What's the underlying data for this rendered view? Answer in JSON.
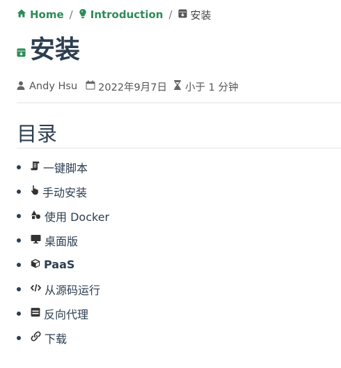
{
  "breadcrumb": {
    "home": {
      "label": "Home",
      "icon": "home-icon"
    },
    "section": {
      "label": "Introduction",
      "icon": "lightbulb-icon"
    },
    "current": {
      "label": "安装",
      "icon": "install-icon"
    }
  },
  "page": {
    "title": "安装",
    "title_icon": "install-icon",
    "accent_color": "#2e8b57"
  },
  "meta": {
    "author": "Andy Hsu",
    "date": "2022年9月7日",
    "reading_time": "小于 1 分钟"
  },
  "toc": {
    "heading": "目录",
    "items": [
      {
        "label": "一键脚本",
        "icon": "script-icon"
      },
      {
        "label": "手动安装",
        "icon": "hand-pointer-icon"
      },
      {
        "label": "使用 Docker",
        "icon": "shapes-icon"
      },
      {
        "label": "桌面版",
        "icon": "desktop-icon"
      },
      {
        "label": "PaaS",
        "icon": "cube-icon"
      },
      {
        "label": "从源码运行",
        "icon": "code-icon"
      },
      {
        "label": "反向代理",
        "icon": "server-icon"
      },
      {
        "label": "下载",
        "icon": "link-icon"
      }
    ]
  }
}
